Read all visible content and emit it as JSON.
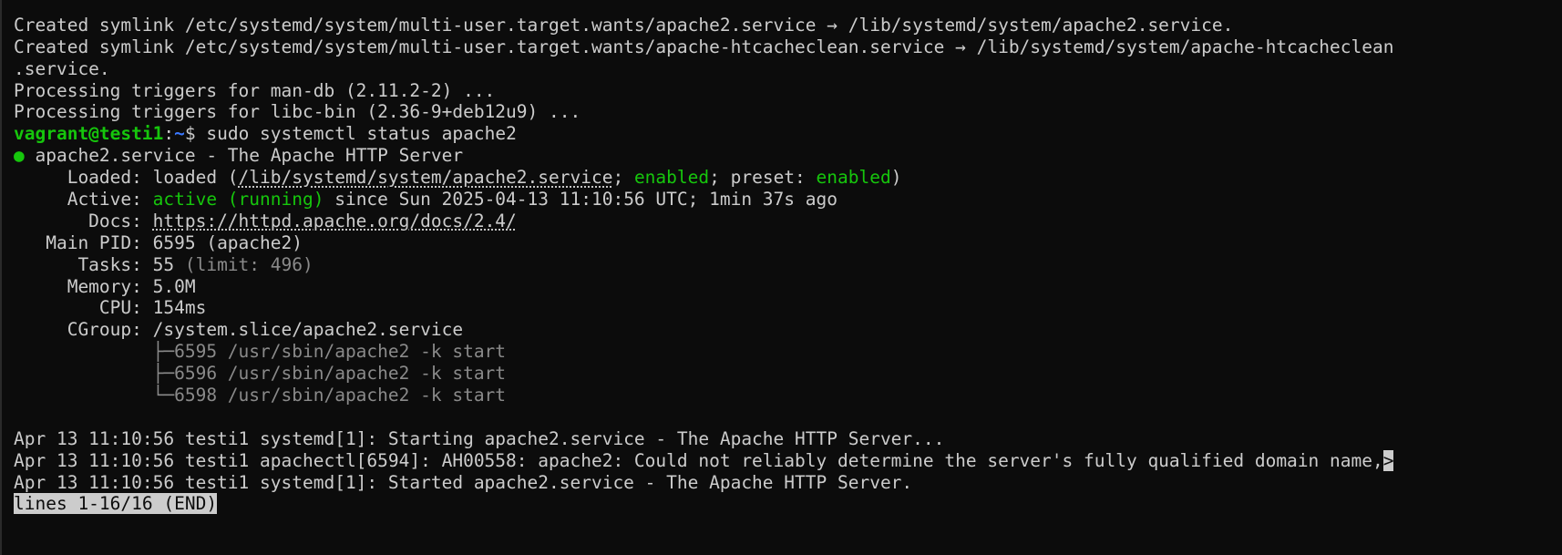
{
  "terminal": {
    "lines": {
      "l0": "Created symlink /etc/systemd/system/multi-user.target.wants/apache2.service → /lib/systemd/system/apache2.service.",
      "l1": "Created symlink /etc/systemd/system/multi-user.target.wants/apache-htcacheclean.service → /lib/systemd/system/apache-htcacheclean",
      "l2": ".service.",
      "l3": "Processing triggers for man-db (2.11.2-2) ...",
      "l4": "Processing triggers for libc-bin (2.36-9+deb12u9) ..."
    },
    "prompt": {
      "user_host": "vagrant@testi1",
      "sep": ":",
      "path": "~",
      "symbol": "$ ",
      "command": "sudo systemctl status apache2"
    },
    "status": {
      "bullet": "●",
      "header": " apache2.service - The Apache HTTP Server",
      "loaded_label": "     Loaded: ",
      "loaded_state": "loaded (",
      "loaded_path": "/lib/systemd/system/apache2.service",
      "loaded_sep": "; ",
      "enabled": "enabled",
      "preset_text": "; preset: ",
      "preset_enabled": "enabled",
      "close_paren": ")",
      "active_label": "     Active: ",
      "active_state": "active (running)",
      "active_rest": " since Sun 2025-04-13 11:10:56 UTC; 1min 37s ago",
      "docs_label": "       Docs: ",
      "docs_url": "https://httpd.apache.org/docs/2.4/",
      "pid_label": "   Main PID: ",
      "pid_value": "6595 (apache2)",
      "tasks_label": "      Tasks: ",
      "tasks_value": "55",
      "tasks_limit": " (limit: 496)",
      "memory_label": "     Memory: ",
      "memory_value": "5.0M",
      "cpu_label": "        CPU: ",
      "cpu_value": "154ms",
      "cgroup_label": "     CGroup: ",
      "cgroup_value": "/system.slice/apache2.service",
      "proc1": "             ├─6595 /usr/sbin/apache2 -k start",
      "proc2": "             ├─6596 /usr/sbin/apache2 -k start",
      "proc3": "             └─6598 /usr/sbin/apache2 -k start"
    },
    "logs": {
      "log1": "Apr 13 11:10:56 testi1 systemd[1]: Starting apache2.service - The Apache HTTP Server...",
      "log2": "Apr 13 11:10:56 testi1 apachectl[6594]: AH00558: apache2: Could not reliably determine the server's fully qualified domain name,",
      "log2_more": ">",
      "log3": "Apr 13 11:10:56 testi1 systemd[1]: Started apache2.service - The Apache HTTP Server."
    },
    "pager_status": "lines 1-16/16 (END)"
  }
}
